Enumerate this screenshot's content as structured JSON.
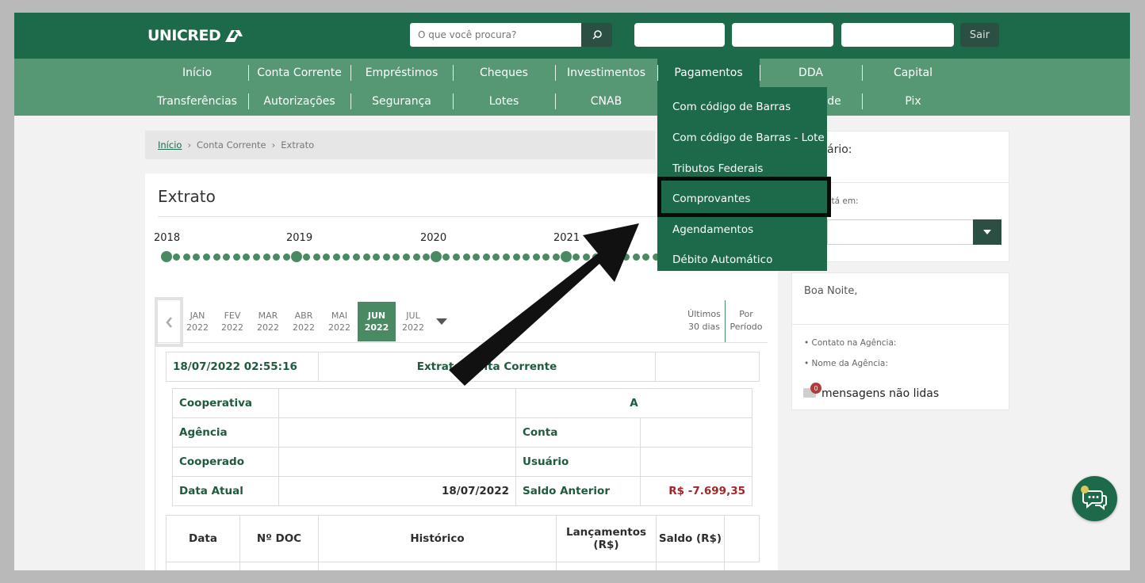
{
  "header": {
    "logo": "UNICRED",
    "search_placeholder": "O que você procura?",
    "logout_label": "Sair"
  },
  "nav": {
    "row1": [
      "Início",
      "Conta Corrente",
      "Empréstimos",
      "Cheques",
      "Investimentos",
      "Pagamentos",
      "DDA",
      "Capital"
    ],
    "row2": [
      "Transferências",
      "Autorizações",
      "Segurança",
      "Lotes",
      "CNAB",
      "de",
      "Pix"
    ],
    "pagamentos_menu": [
      "Com código de Barras",
      "Com código de Barras - Lote",
      "Tributos Federais",
      "Comprovantes",
      "Agendamentos",
      "Débito Automático"
    ]
  },
  "breadcrumb": [
    "Início",
    "Conta Corrente",
    "Extrato"
  ],
  "page_title": "Extrato",
  "timeline": {
    "years": [
      "2018",
      "2019",
      "2020",
      "2021"
    ]
  },
  "months": [
    {
      "m": "JAN",
      "y": "2022"
    },
    {
      "m": "FEV",
      "y": "2022"
    },
    {
      "m": "MAR",
      "y": "2022"
    },
    {
      "m": "ABR",
      "y": "2022"
    },
    {
      "m": "MAI",
      "y": "2022"
    },
    {
      "m": "JUN",
      "y": "2022"
    },
    {
      "m": "JUL",
      "y": "2022"
    }
  ],
  "selected_month": "JUN 2022",
  "period_options": {
    "last30": [
      "Últimos",
      "30 dias"
    ],
    "period": [
      "Por",
      "Período"
    ]
  },
  "statement": {
    "datetime": "18/07/2022 02:55:16",
    "title": "Extrato Conta Corrente",
    "a_label": "A",
    "cooperativa_label": "Cooperativa",
    "agencia_label": "Agência",
    "conta_label": "Conta",
    "cooperado_label": "Cooperado",
    "usuario_label": "Usuário",
    "data_atual_label": "Data Atual",
    "data_atual_value": "18/07/2022",
    "saldo_anterior_label": "Saldo Anterior",
    "saldo_anterior_value": "R$ -7.699,35",
    "columns": [
      "Data",
      "Nº DOC",
      "Histórico",
      "Lançamentos (R$)",
      "Saldo (R$)"
    ]
  },
  "filter": {
    "title": "ário:",
    "label": "stá em:"
  },
  "welcome": {
    "greeting": "Boa Noite,",
    "items": [
      "Contato na Agência:",
      "Nome da Agência:"
    ],
    "unread_count": "0",
    "unread_label": "mensagens não lidas"
  },
  "colors": {
    "brand_dark": "#1d6a4b",
    "nav_green": "#569873",
    "negative": "#a3262a",
    "highlight_border": "#0a0a0a"
  }
}
